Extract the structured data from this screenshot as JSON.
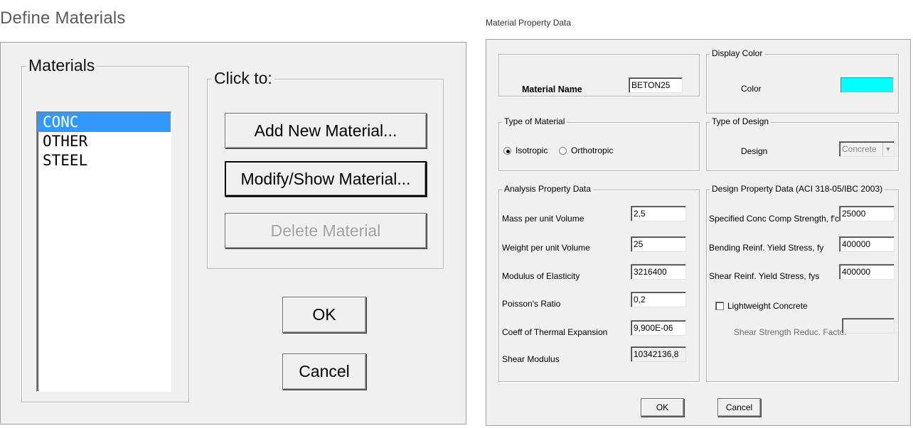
{
  "define_materials": {
    "title": "Define Materials",
    "materials_group_label": "Materials",
    "materials": [
      "CONC",
      "OTHER",
      "STEEL"
    ],
    "selected_material": "CONC",
    "click_to_label": "Click to:",
    "add_button": "Add New Material...",
    "modify_button": "Modify/Show Material...",
    "delete_button": "Delete Material",
    "ok_button": "OK",
    "cancel_button": "Cancel"
  },
  "material_property": {
    "title": "Material Property Data",
    "material_name_label": "Material Name",
    "material_name_value": "BETON25",
    "display_color_label": "Display Color",
    "color_label": "Color",
    "color_value": "#00ffff",
    "type_of_material_label": "Type of Material",
    "isotropic_label": "Isotropic",
    "orthotropic_label": "Orthotropic",
    "material_type_selected": "Isotropic",
    "type_of_design_label": "Type of Design",
    "design_label": "Design",
    "design_value": "Concrete",
    "analysis_label": "Analysis Property Data",
    "analysis": [
      {
        "label": "Mass per unit Volume",
        "value": "2,5"
      },
      {
        "label": "Weight per unit Volume",
        "value": "25"
      },
      {
        "label": "Modulus of Elasticity",
        "value": "3216400"
      },
      {
        "label": "Poisson's Ratio",
        "value": "0,2"
      },
      {
        "label": "Coeff of Thermal Expansion",
        "value": "9,900E-06"
      },
      {
        "label": "Shear Modulus",
        "value": "10342136,8"
      }
    ],
    "design_data_label": "Design Property Data (ACI 318-05/IBC 2003)",
    "design_data": [
      {
        "label": "Specified Conc Comp Strength, f'c",
        "value": "25000"
      },
      {
        "label": "Bending Reinf. Yield Stress, fy",
        "value": "400000"
      },
      {
        "label": "Shear Reinf. Yield Stress, fys",
        "value": "400000"
      }
    ],
    "lightweight_label": "Lightweight Concrete",
    "lightweight_checked": false,
    "shear_reduc_label": "Shear Strength Reduc. Factor",
    "shear_reduc_value": "",
    "ok_button": "OK",
    "cancel_button": "Cancel"
  }
}
